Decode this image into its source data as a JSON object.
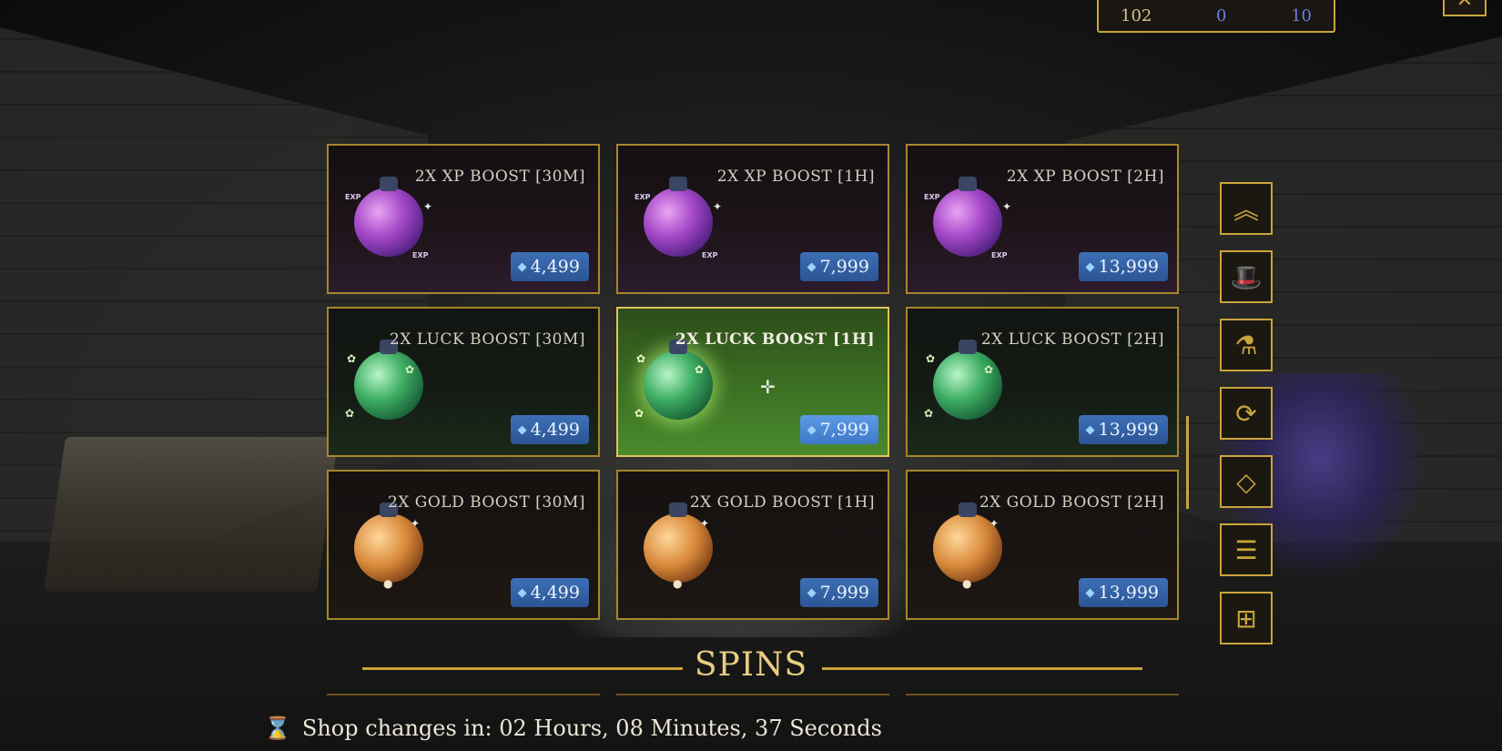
{
  "currency": {
    "gold": "102",
    "middle": "0",
    "gems": "10"
  },
  "close_icon": "close-icon",
  "items": [
    {
      "title": "2X XP BOOST [30M]",
      "price": "4,499",
      "kind": "xp"
    },
    {
      "title": "2X XP BOOST [1H]",
      "price": "7,999",
      "kind": "xp"
    },
    {
      "title": "2X XP BOOST [2H]",
      "price": "13,999",
      "kind": "xp"
    },
    {
      "title": "2X LUCK BOOST [30M]",
      "price": "4,499",
      "kind": "luck"
    },
    {
      "title": "2X LUCK BOOST [1H]",
      "price": "7,999",
      "kind": "luck",
      "selected": true
    },
    {
      "title": "2X LUCK BOOST [2H]",
      "price": "13,999",
      "kind": "luck"
    },
    {
      "title": "2X GOLD BOOST [30M]",
      "price": "4,499",
      "kind": "gold"
    },
    {
      "title": "2X GOLD BOOST [1H]",
      "price": "7,999",
      "kind": "gold"
    },
    {
      "title": "2X GOLD BOOST [2H]",
      "price": "13,999",
      "kind": "gold"
    }
  ],
  "side_menu": [
    {
      "icon": "rank-chevron-icon"
    },
    {
      "icon": "top-hat-icon"
    },
    {
      "icon": "potion-icon"
    },
    {
      "icon": "refresh-arrows-icon"
    },
    {
      "icon": "diamond-icon"
    },
    {
      "icon": "coin-stack-icon"
    },
    {
      "icon": "gift-box-icon"
    }
  ],
  "section_heading": "SPINS",
  "timer": {
    "text": "Shop changes in: 02 Hours, 08 Minutes, 37 Seconds",
    "icon": "hourglass-icon"
  },
  "colors": {
    "accent_gold": "#c9a43a",
    "price_blue": "#2b5594",
    "selected_green": "#3a6d22"
  }
}
